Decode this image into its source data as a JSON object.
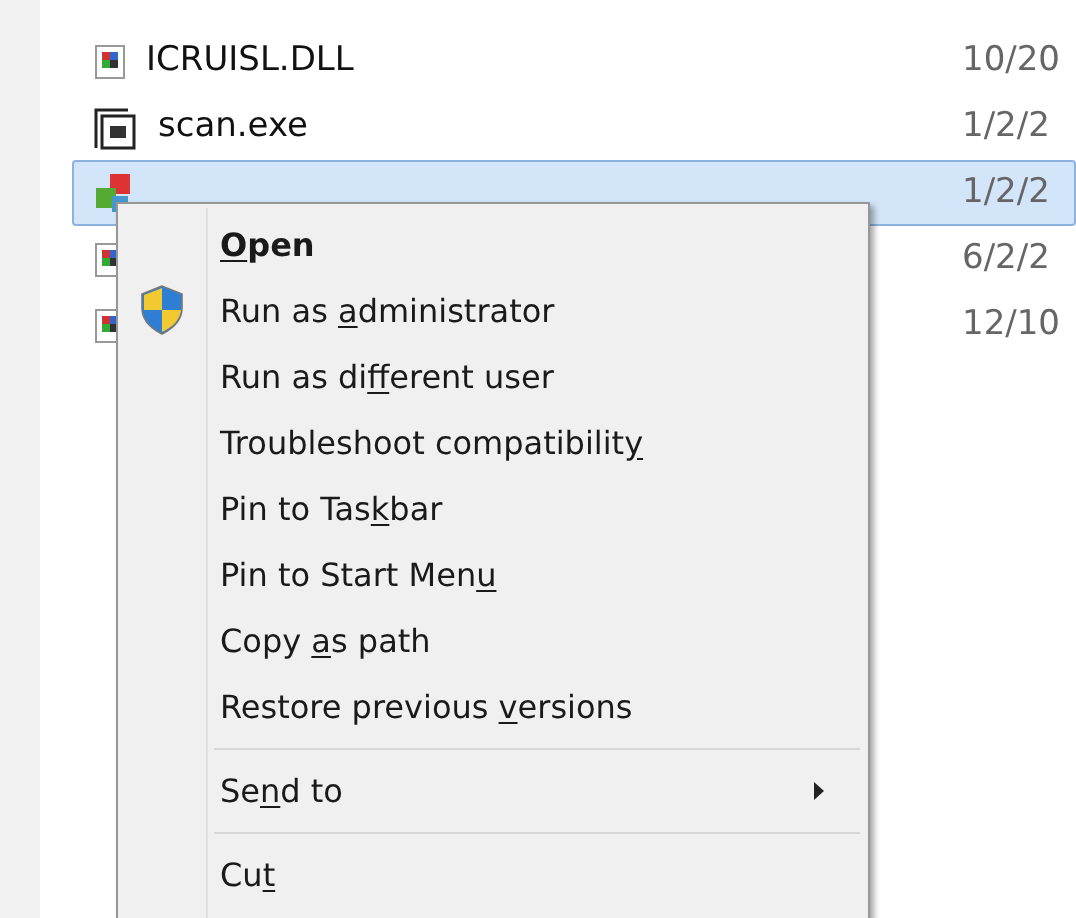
{
  "files": [
    {
      "name": "ICRUISL.DLL",
      "date": "10/20",
      "kind": "dll",
      "selected": false
    },
    {
      "name": "scan.exe",
      "date": "1/2/2",
      "kind": "exe",
      "selected": false
    },
    {
      "date": "1/2/2",
      "kind": "installer",
      "selected": true
    },
    {
      "date": "6/2/2",
      "kind": "dll",
      "selected": false
    },
    {
      "date": "12/10",
      "kind": "dll",
      "selected": false
    }
  ],
  "context_menu": {
    "items": [
      {
        "kind": "item",
        "key": "O",
        "after": "pen",
        "bold": true
      },
      {
        "kind": "item",
        "before": "Run as ",
        "key": "a",
        "after": "dministrator",
        "shield": true
      },
      {
        "kind": "item",
        "before": "Run as di",
        "key": "f",
        "after": "ferent user"
      },
      {
        "kind": "item",
        "before": "Troubleshoot compatibilit",
        "key": "y"
      },
      {
        "kind": "item",
        "before": "Pin to Tas",
        "key": "k",
        "after": "bar"
      },
      {
        "kind": "item",
        "before": "Pin to Start Men",
        "key": "u"
      },
      {
        "kind": "item",
        "before": "Copy ",
        "key": "a",
        "after": "s path"
      },
      {
        "kind": "item",
        "before": "Restore previous ",
        "key": "v",
        "after": "ersions"
      },
      {
        "kind": "separator"
      },
      {
        "kind": "item",
        "before": "Se",
        "key": "n",
        "after": "d to",
        "submenu": true
      },
      {
        "kind": "separator"
      },
      {
        "kind": "item",
        "before": "Cu",
        "key": "t"
      }
    ]
  }
}
